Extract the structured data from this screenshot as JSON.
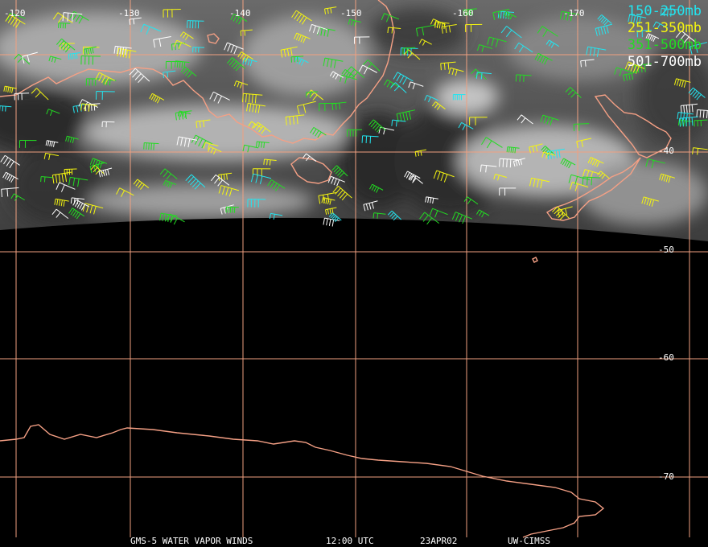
{
  "colors": {
    "graticule": "#f0a080",
    "coastline": "#f5a085",
    "earth_edge": "#000000"
  },
  "grid": {
    "lon_labels": [
      "-120",
      "-130",
      "-140",
      "-150",
      "-160",
      "-170"
    ],
    "lat_labels": [
      "-40",
      "-50",
      "-60",
      "-70"
    ]
  },
  "legend": [
    {
      "label": "150-250mb",
      "color": "#22e5f0"
    },
    {
      "label": "251-350mb",
      "color": "#f5f510"
    },
    {
      "label": "351-500mb",
      "color": "#22dd22"
    },
    {
      "label": "501-700mb",
      "color": "#ffffff"
    }
  ],
  "footer": {
    "product": "GMS-5 WATER VAPOR WINDS",
    "time": "12:00 UTC",
    "date": "23APR02",
    "source": "UW-CIMSS"
  }
}
